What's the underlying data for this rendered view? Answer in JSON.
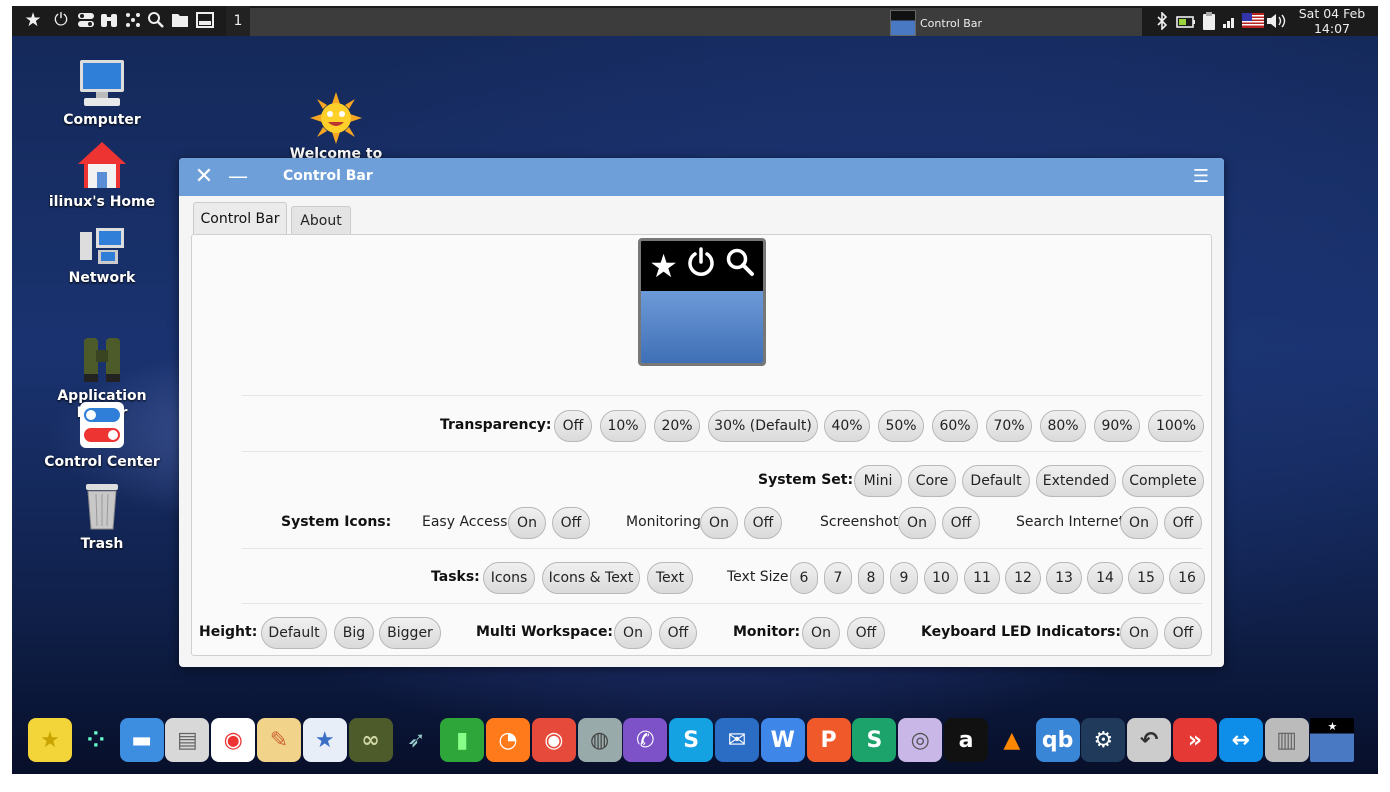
{
  "top_panel": {
    "launchers": [
      {
        "icon": "star-icon",
        "glyph": "★"
      },
      {
        "icon": "power-icon",
        "glyph": "⏻"
      },
      {
        "icon": "toggle-icon",
        "glyph": "☷"
      },
      {
        "icon": "binoculars-icon",
        "glyph": "⛯"
      },
      {
        "icon": "apps-grid-icon",
        "glyph": "⁙"
      },
      {
        "icon": "search-icon",
        "glyph": "⚲"
      },
      {
        "icon": "folder-icon",
        "glyph": "▬"
      },
      {
        "icon": "window-icon",
        "glyph": "▣"
      }
    ],
    "workspace": "1",
    "task_label": "Control Bar",
    "tray": [
      "bluetooth-icon",
      "battery-icon",
      "clipboard-icon",
      "signal-icon",
      "us-flag-icon",
      "volume-icon"
    ],
    "clock_date": "Sat 04 Feb",
    "clock_time": "14:07"
  },
  "desktop_icons": [
    {
      "label": "Computer",
      "icon": "computer-icon"
    },
    {
      "label": "Welcome to\niLinux!",
      "icon": "sun-icon"
    },
    {
      "label": "ilinux's Home",
      "icon": "home-icon"
    },
    {
      "label": "Network",
      "icon": "network-icon"
    },
    {
      "label": "Application\nFinder",
      "icon": "binoculars-icon"
    },
    {
      "label": "Control Center",
      "icon": "toggle-icon"
    },
    {
      "label": "Trash",
      "icon": "trash-icon"
    }
  ],
  "window": {
    "title": "Control Bar",
    "tabs": [
      "Control Bar",
      "About"
    ],
    "transparency": {
      "label": "Transparency:",
      "options": [
        "Off",
        "10%",
        "20%",
        "30% (Default)",
        "40%",
        "50%",
        "60%",
        "70%",
        "80%",
        "90%",
        "100%"
      ]
    },
    "system_set": {
      "label": "System Set:",
      "options": [
        "Mini",
        "Core",
        "Default",
        "Extended",
        "Complete"
      ]
    },
    "system_icons": {
      "label": "System Icons:",
      "groups": [
        {
          "label": "Easy Access",
          "on": "On",
          "off": "Off"
        },
        {
          "label": "Monitoring",
          "on": "On",
          "off": "Off"
        },
        {
          "label": "Screenshot",
          "on": "On",
          "off": "Off"
        },
        {
          "label": "Search Internet",
          "on": "On",
          "off": "Off"
        }
      ]
    },
    "tasks": {
      "label": "Tasks:",
      "options": [
        "Icons",
        "Icons & Text",
        "Text"
      ],
      "text_size_label": "Text Size",
      "sizes": [
        "6",
        "7",
        "8",
        "9",
        "10",
        "11",
        "12",
        "13",
        "14",
        "15",
        "16"
      ]
    },
    "height": {
      "label": "Height:",
      "options": [
        "Default",
        "Big",
        "Bigger"
      ]
    },
    "multi_workspace": {
      "label": "Multi Workspace:",
      "on": "On",
      "off": "Off"
    },
    "monitor": {
      "label": "Monitor:",
      "on": "On",
      "off": "Off"
    },
    "keyboard_led": {
      "label": "Keyboard LED Indicators:",
      "on": "On",
      "off": "Off"
    }
  },
  "dock": [
    "star-icon",
    "apps-dots-icon",
    "window-icon",
    "file-cabinet-icon",
    "toggle-icon",
    "palette-icon",
    "store-icon",
    "binoculars-icon",
    "rocket-icon",
    "pipe-icon",
    "firefox-icon",
    "chrome-icon",
    "google-earth-pro-icon",
    "viber-icon",
    "skype-icon",
    "mail-icon",
    "wps-writer-icon",
    "wps-presentation-icon",
    "wps-spreadsheet-icon",
    "webcam-icon",
    "amazon-icon",
    "vlc-icon",
    "qbittorrent-icon",
    "steam-icon",
    "timeshift-icon",
    "anydesk-icon",
    "teamviewer-icon",
    "trash-icon",
    "control-bar-icon"
  ]
}
